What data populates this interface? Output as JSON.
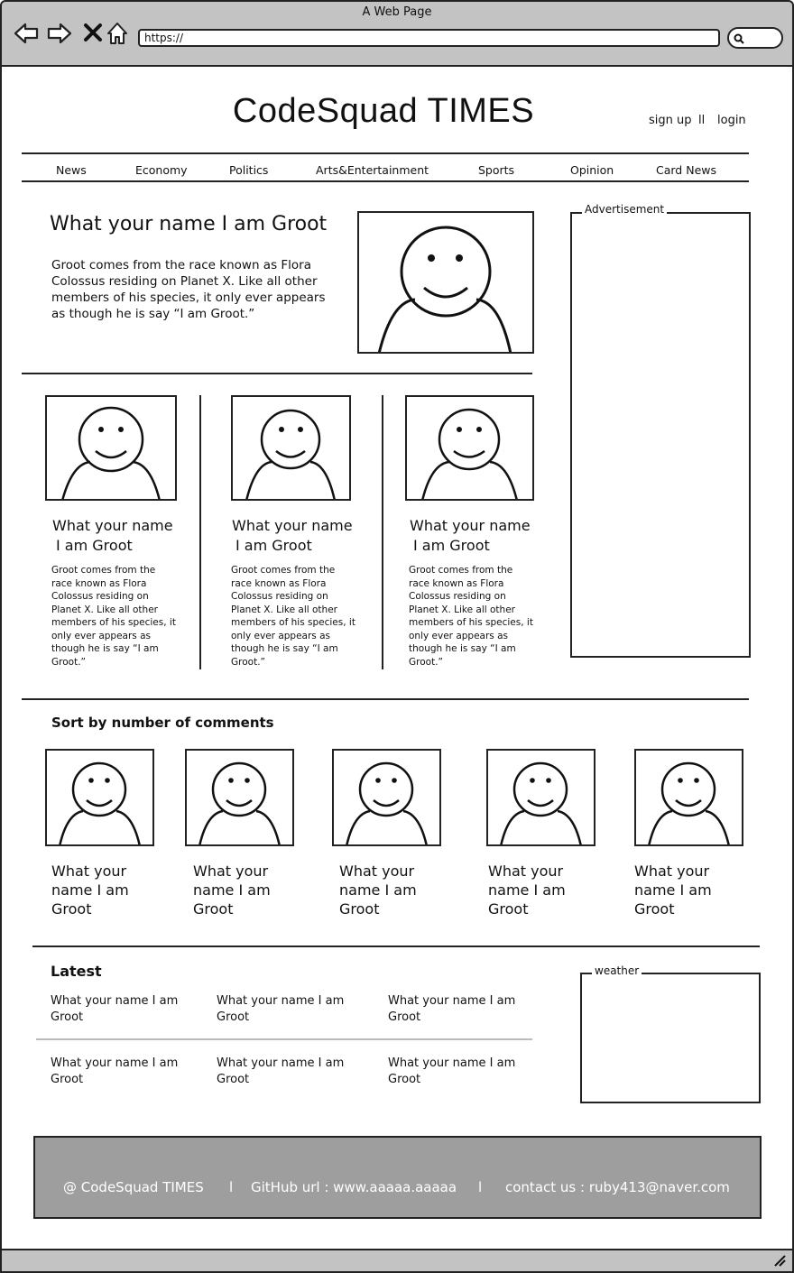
{
  "browser": {
    "window_title": "A Web Page",
    "url": "https://",
    "icons": [
      "back-arrow-icon",
      "forward-arrow-icon",
      "close-icon",
      "home-icon",
      "search-icon"
    ]
  },
  "header": {
    "site_title": "CodeSquad TIMES",
    "sign_up": "sign up",
    "separator": "ll",
    "login": "login"
  },
  "nav": {
    "items": [
      "News",
      "Economy",
      "Politics",
      "Arts&Entertainment",
      "Sports",
      "Opinion",
      "Card News"
    ]
  },
  "featured": {
    "title": "What your name I am Groot",
    "body": "Groot comes from the race known as Flora Colossus residing on Planet X. Like all other members of his species, it only ever appears as though he is say “I am Groot.”"
  },
  "advertisement": {
    "label": "Advertisement"
  },
  "cards": [
    {
      "title_line1": "What your name",
      "title_line2": "I am Groot",
      "body": "Groot comes from the race known as Flora Colossus residing on Planet X. Like all other members of his species, it only ever appears as though he is say “I am Groot.”"
    },
    {
      "title_line1": "What your name",
      "title_line2": "I am Groot",
      "body": "Groot comes from the race known as Flora Colossus residing on Planet X. Like all other members of his species, it only ever appears as though he is say “I am Groot.”"
    },
    {
      "title_line1": "What your name",
      "title_line2": "I am Groot",
      "body": "Groot comes from the race known as Flora Colossus residing on Planet X. Like all other members of his species, it only ever appears as though he is say “I am Groot.”"
    }
  ],
  "sort_section": {
    "heading": "Sort by number of comments",
    "items": [
      {
        "title": "What your name I am Groot"
      },
      {
        "title": "What your name I am Groot"
      },
      {
        "title": "What your name I am Groot"
      },
      {
        "title": "What your name I am Groot"
      },
      {
        "title": "What your name I am Groot"
      }
    ]
  },
  "latest": {
    "heading": "Latest",
    "items": [
      "What your name I am Groot",
      "What your name I am Groot",
      "What your name I am Groot",
      "What your name I am Groot",
      "What your name I am Groot",
      "What your name I am Groot"
    ]
  },
  "weather": {
    "label": "weather"
  },
  "footer": {
    "copyright": "@ CodeSquad TIMES",
    "divider": "l",
    "github": "GitHub url : www.aaaaa.aaaaa",
    "contact": "contact us : ruby413@naver.com"
  }
}
